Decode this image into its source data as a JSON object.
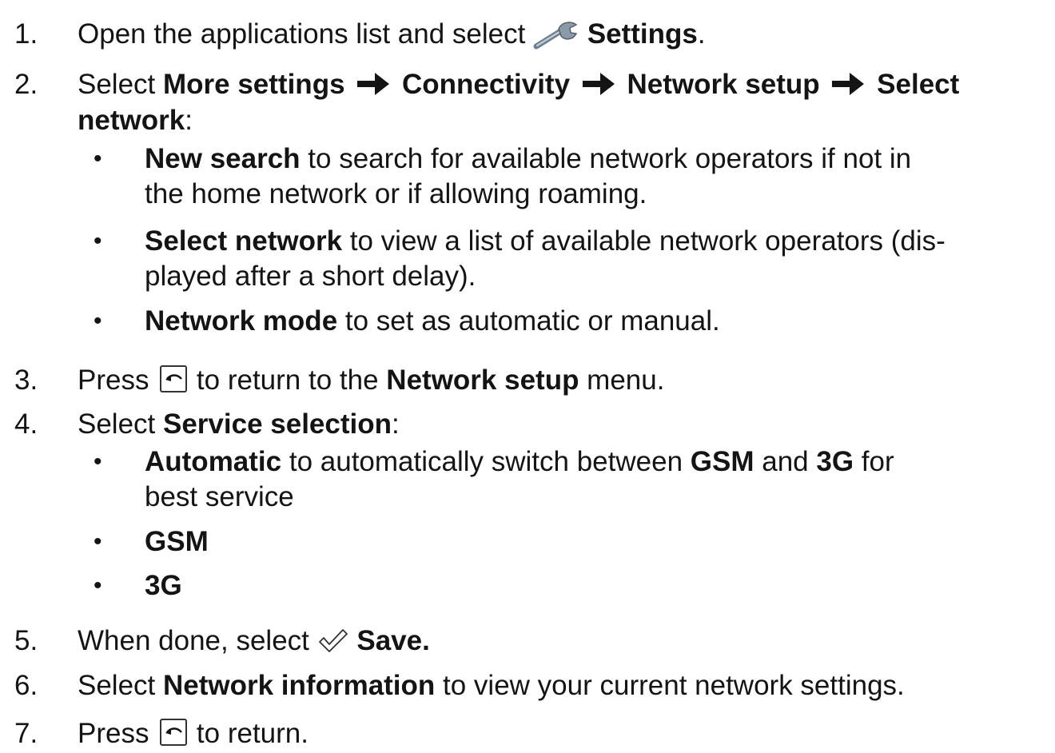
{
  "steps": {
    "s1": {
      "num": "1.",
      "a": "Open the applications list and select ",
      "b": "Settings",
      "c": ".",
      "icon": "wrench-icon"
    },
    "s2": {
      "num": "2.",
      "a": "Select ",
      "b1": "More settings",
      "b2": "Connectivity",
      "b3": "Network setup",
      "b4": "Select",
      "line2b": "network",
      "line2c": ":",
      "arrow": "right-arrow-icon"
    },
    "s2_bullets": [
      {
        "bold": "New search",
        "rest": " to search for available network operators if not in",
        "line2": "the home network or if allowing roaming."
      },
      {
        "bold": "Select network",
        "rest": " to view a list of available network operators (dis-",
        "line2": "played after a short delay)."
      },
      {
        "bold": "Network mode",
        "rest": " to set as automatic or manual."
      }
    ],
    "s3": {
      "num": "3.",
      "a": "Press ",
      "b": " to return to the ",
      "c": "Network setup",
      "d": " menu.",
      "icon": "back-key-icon"
    },
    "s4": {
      "num": "4.",
      "a": "Select ",
      "b": "Service selection",
      "c": ":"
    },
    "s4_bullets": [
      {
        "bold": "Automatic",
        "rest1": " to automatically switch between ",
        "bold2": "GSM",
        "rest2": " and ",
        "bold3": "3G",
        "rest3": " for",
        "line2": "best service"
      },
      {
        "bold": "GSM"
      },
      {
        "bold": "3G"
      }
    ],
    "s5": {
      "num": "5.",
      "a": "When done, select ",
      "b": "Save.",
      "icon": "checkmark-icon"
    },
    "s6": {
      "num": "6.",
      "a": "Select ",
      "b": "Network information",
      "c": " to view your current network settings."
    },
    "s7": {
      "num": "7.",
      "a": "Press ",
      "b": " to return.",
      "icon": "back-key-icon"
    }
  },
  "bullet_char": "•",
  "colors": {
    "text": "#141414",
    "wrench": "#8a9aa8"
  }
}
